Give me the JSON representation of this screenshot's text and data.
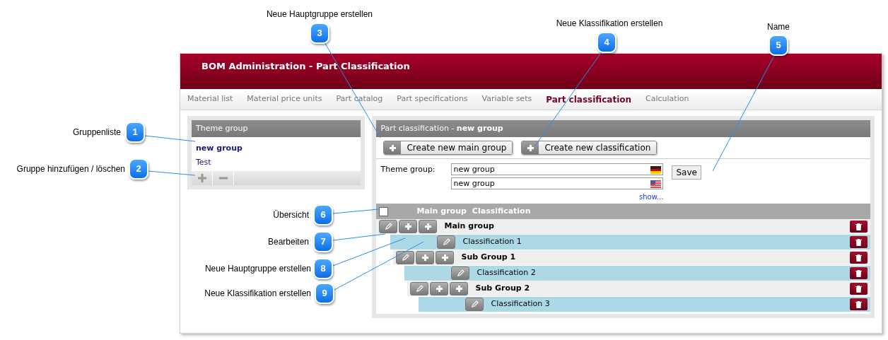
{
  "callouts": [
    {
      "number": "1",
      "label": "Gruppenliste"
    },
    {
      "number": "2",
      "label": "Gruppe hinzufügen / löschen"
    },
    {
      "number": "3",
      "label": "Neue Hauptgruppe erstellen"
    },
    {
      "number": "4",
      "label": "Neue Klassifikation erstellen"
    },
    {
      "number": "5",
      "label": "Name"
    },
    {
      "number": "6",
      "label": "Übersicht"
    },
    {
      "number": "7",
      "label": "Bearbeiten"
    },
    {
      "number": "8",
      "label": "Neue Hauptgruppe erstellen"
    },
    {
      "number": "9",
      "label": "Neue Klassifikation erstellen"
    }
  ],
  "app": {
    "title": "BOM Administration - Part Classification",
    "nav": [
      {
        "label": "Material list",
        "selected": false
      },
      {
        "label": "Material price units",
        "selected": false
      },
      {
        "label": "Part catalog",
        "selected": false
      },
      {
        "label": "Part specifications",
        "selected": false
      },
      {
        "label": "Variable sets",
        "selected": false
      },
      {
        "label": "Part classification",
        "selected": true
      },
      {
        "label": "Calculation",
        "selected": false
      }
    ],
    "theme_group_panel": {
      "title": "Theme group",
      "items": [
        {
          "label": "new group",
          "selected": true
        },
        {
          "label": "Test",
          "selected": false
        }
      ]
    },
    "classification_panel": {
      "title": "Part classification - **new group**",
      "buttons": [
        "Create new main group",
        "Create new classification"
      ],
      "form": {
        "label": "Theme group:",
        "fields": [
          {
            "value": "new group",
            "kind": "de"
          },
          {
            "value": "new group",
            "kind": "us"
          }
        ],
        "save": "Save",
        "show_link": "show..."
      },
      "tree_header": {
        "checked": false,
        "columns": [
          "Main group",
          "Classification"
        ]
      },
      "tree": [
        {
          "kind": "group",
          "label": "Main group",
          "children": [
            {
              "kind": "classification",
              "label": "Classification 1"
            },
            {
              "kind": "group",
              "label": "Sub Group 1",
              "children": [
                {
                  "kind": "classification",
                  "label": "Classification 2"
                },
                {
                  "kind": "group",
                  "label": "Sub Group 2",
                  "children": [
                    {
                      "kind": "classification",
                      "label": "Classification 3"
                    }
                  ]
                }
              ]
            }
          ]
        }
      ]
    }
  }
}
